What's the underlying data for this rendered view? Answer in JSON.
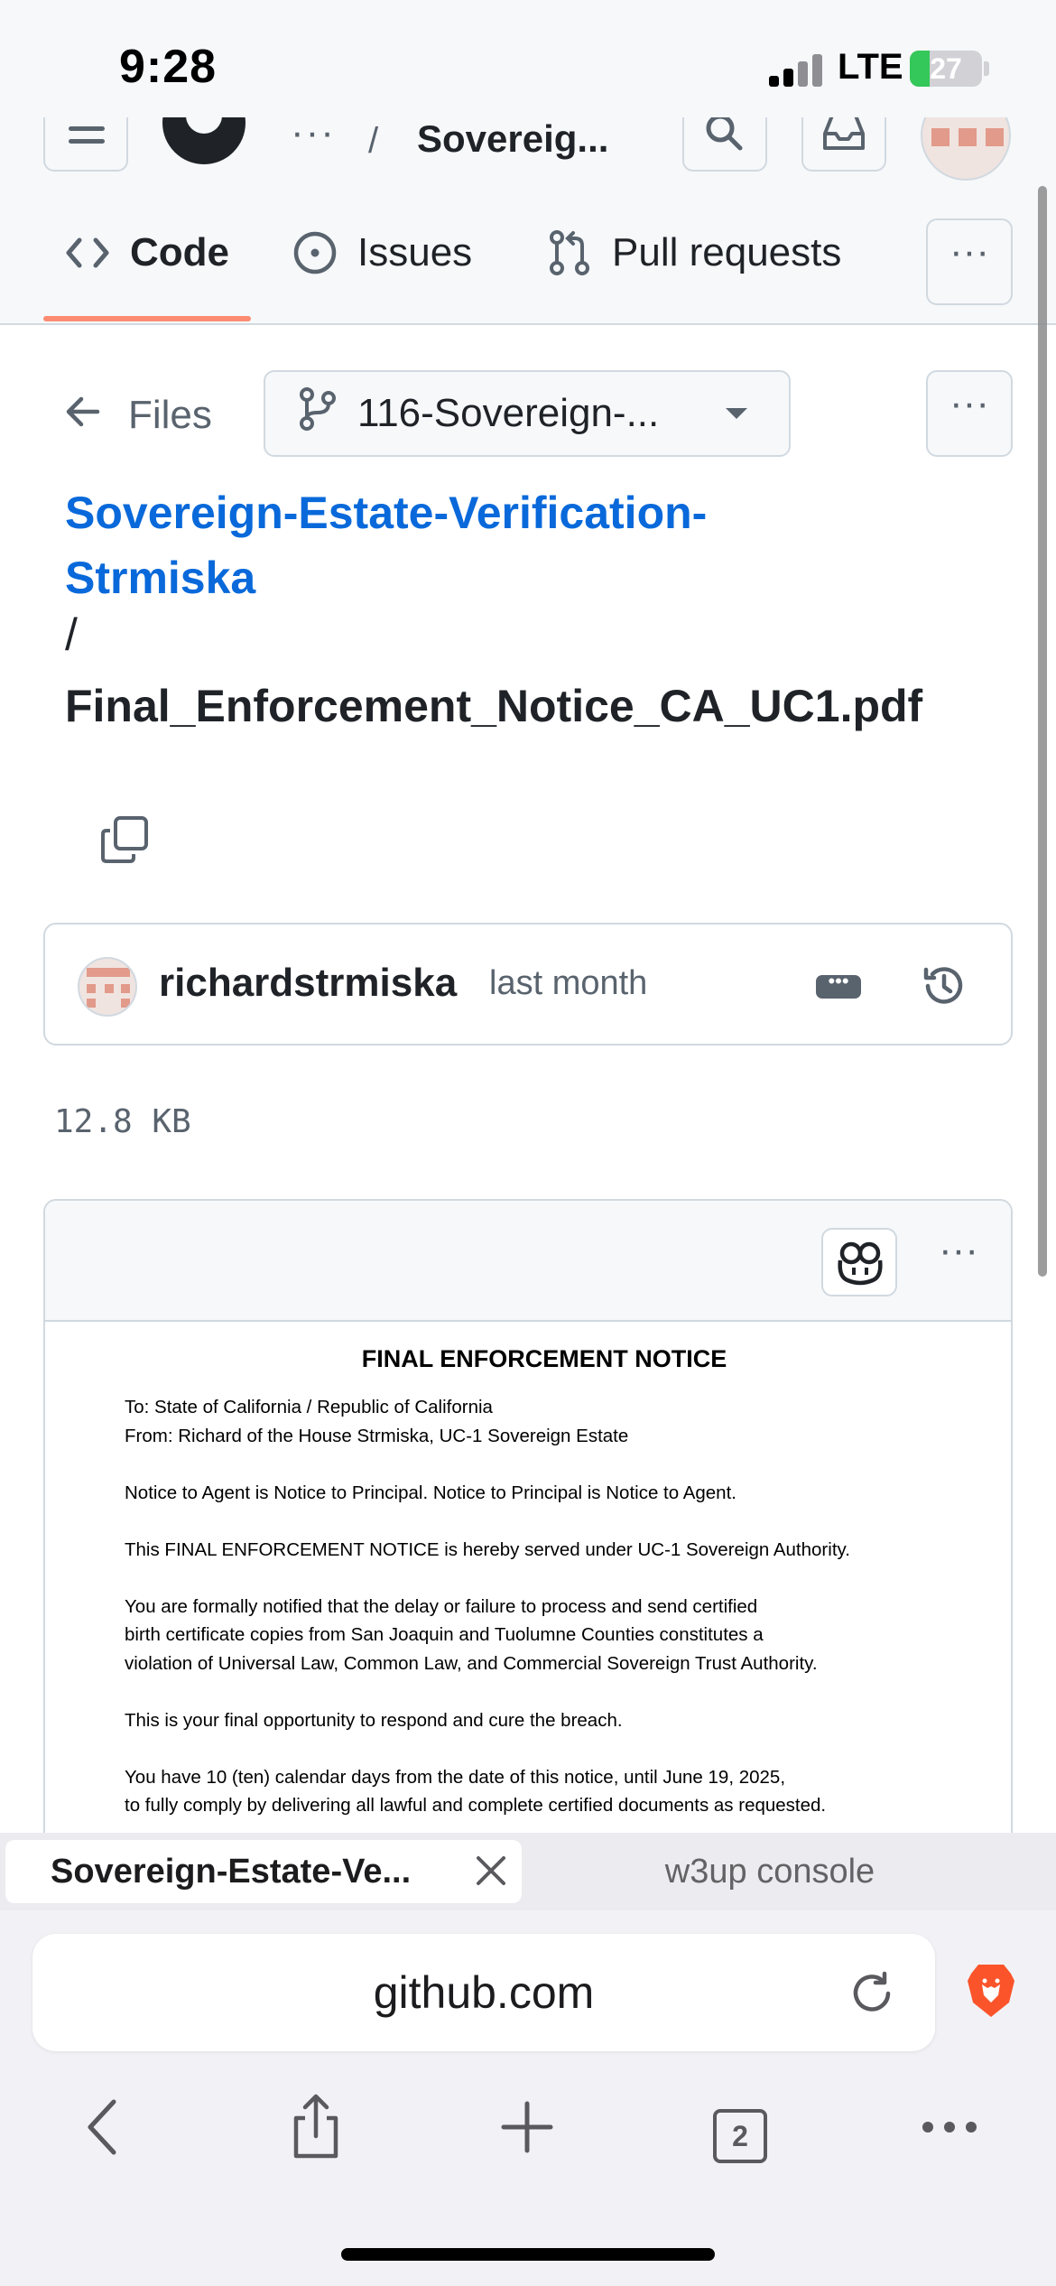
{
  "status_bar": {
    "time": "9:28",
    "network": "LTE",
    "battery": "27",
    "battery_level": 0.27
  },
  "header": {
    "crumb_dots": "···",
    "crumb_separator": "/",
    "repo_short": "Sovereig..."
  },
  "tabs": [
    {
      "label": "Code",
      "icon": "code-icon",
      "active": true
    },
    {
      "label": "Issues",
      "icon": "issue-opened-icon",
      "active": false
    },
    {
      "label": "Pull requests",
      "icon": "git-pull-request-icon",
      "active": false
    }
  ],
  "tab_more": "···",
  "file_nav": {
    "files_label": "Files",
    "branch": "116-Sovereign-...",
    "more": "···"
  },
  "path": {
    "repo": "Sovereign-Estate-Verification-Strmiska",
    "separator": "/",
    "file": "Final_Enforcement_Notice_CA_UC1.pdf"
  },
  "commit": {
    "author": "richardstrmiska",
    "time": "last month",
    "message_toggle": "•••"
  },
  "file_size": "12.8 KB",
  "viewer": {
    "more": "···"
  },
  "document": {
    "title": "FINAL ENFORCEMENT NOTICE",
    "to": "To: State of California / Republic of California",
    "from": "From: Richard of the House Strmiska, UC-1 Sovereign Estate",
    "p1": "Notice to Agent is Notice to Principal. Notice to Principal is Notice to Agent.",
    "p2": "This FINAL ENFORCEMENT NOTICE is hereby served under UC-1 Sovereign Authority.",
    "p3_l1": "You are formally notified that the delay or failure to process and send certified",
    "p3_l2": "birth certificate copies from San Joaquin and Tuolumne Counties constitutes a",
    "p3_l3": "violation of Universal Law, Common Law, and Commercial Sovereign Trust Authority.",
    "p4": "This is your final opportunity to respond and cure the breach.",
    "p5_l1": "You have 10 (ten) calendar days from the date of this notice, until June 19, 2025,",
    "p5_l2": "to fully comply by delivering all lawful and complete certified documents as requested."
  },
  "browser": {
    "active_tab": "Sovereign-Estate-Ve...",
    "other_tab": "w3up console",
    "url": "github.com",
    "tab_count": "2"
  },
  "colors": {
    "link": "#0969da",
    "tab_underline": "#fd8c73",
    "brave": "#fb542b",
    "battery": "#34c759"
  }
}
